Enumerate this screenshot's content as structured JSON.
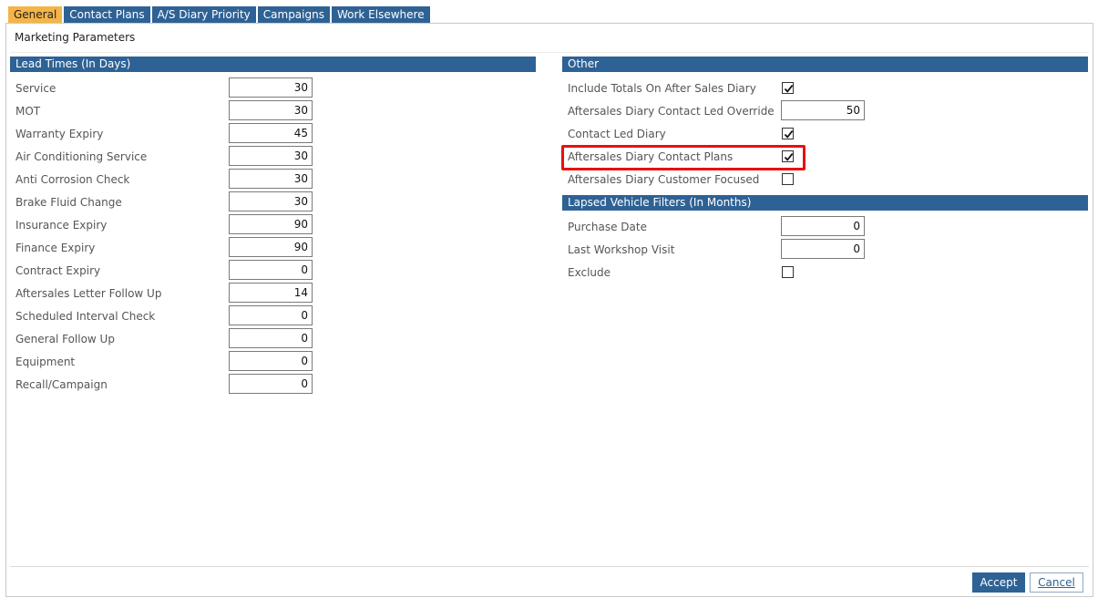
{
  "tabs": [
    {
      "label": "General",
      "active": true
    },
    {
      "label": "Contact Plans",
      "active": false
    },
    {
      "label": "A/S Diary Priority",
      "active": false
    },
    {
      "label": "Campaigns",
      "active": false
    },
    {
      "label": "Work Elsewhere",
      "active": false
    }
  ],
  "panel_title": "Marketing Parameters",
  "lead_times": {
    "header": "Lead Times (In Days)",
    "rows": [
      {
        "label": "Service",
        "value": "30"
      },
      {
        "label": "MOT",
        "value": "30"
      },
      {
        "label": "Warranty Expiry",
        "value": "45"
      },
      {
        "label": "Air Conditioning Service",
        "value": "30"
      },
      {
        "label": "Anti Corrosion Check",
        "value": "30"
      },
      {
        "label": "Brake Fluid Change",
        "value": "30"
      },
      {
        "label": "Insurance Expiry",
        "value": "90"
      },
      {
        "label": "Finance Expiry",
        "value": "90"
      },
      {
        "label": "Contract Expiry",
        "value": "0"
      },
      {
        "label": "Aftersales Letter Follow Up",
        "value": "14"
      },
      {
        "label": "Scheduled Interval Check",
        "value": "0"
      },
      {
        "label": "General Follow Up",
        "value": "0"
      },
      {
        "label": "Equipment",
        "value": "0"
      },
      {
        "label": "Recall/Campaign",
        "value": "0"
      }
    ]
  },
  "other": {
    "header": "Other",
    "rows": [
      {
        "label": "Include Totals On After Sales Diary",
        "type": "checkbox",
        "checked": true
      },
      {
        "label": "Aftersales Diary Contact Led Override",
        "type": "number",
        "value": "50"
      },
      {
        "label": "Contact Led Diary",
        "type": "checkbox",
        "checked": true
      },
      {
        "label": "Aftersales Diary Contact Plans",
        "type": "checkbox",
        "checked": true,
        "highlighted": true
      },
      {
        "label": "Aftersales Diary Customer Focused",
        "type": "checkbox",
        "checked": false
      }
    ]
  },
  "lapsed": {
    "header": "Lapsed Vehicle Filters (In Months)",
    "rows": [
      {
        "label": "Purchase Date",
        "type": "number",
        "value": "0"
      },
      {
        "label": "Last Workshop Visit",
        "type": "number",
        "value": "0"
      },
      {
        "label": "Exclude",
        "type": "checkbox",
        "checked": false
      }
    ]
  },
  "buttons": {
    "accept": "Accept",
    "cancel": "Cancel"
  },
  "colors": {
    "header_bg": "#2e6295",
    "active_tab_bg": "#f4b447",
    "highlight_border": "#e81010"
  },
  "icons": {
    "checkmark": "checkmark-icon"
  }
}
